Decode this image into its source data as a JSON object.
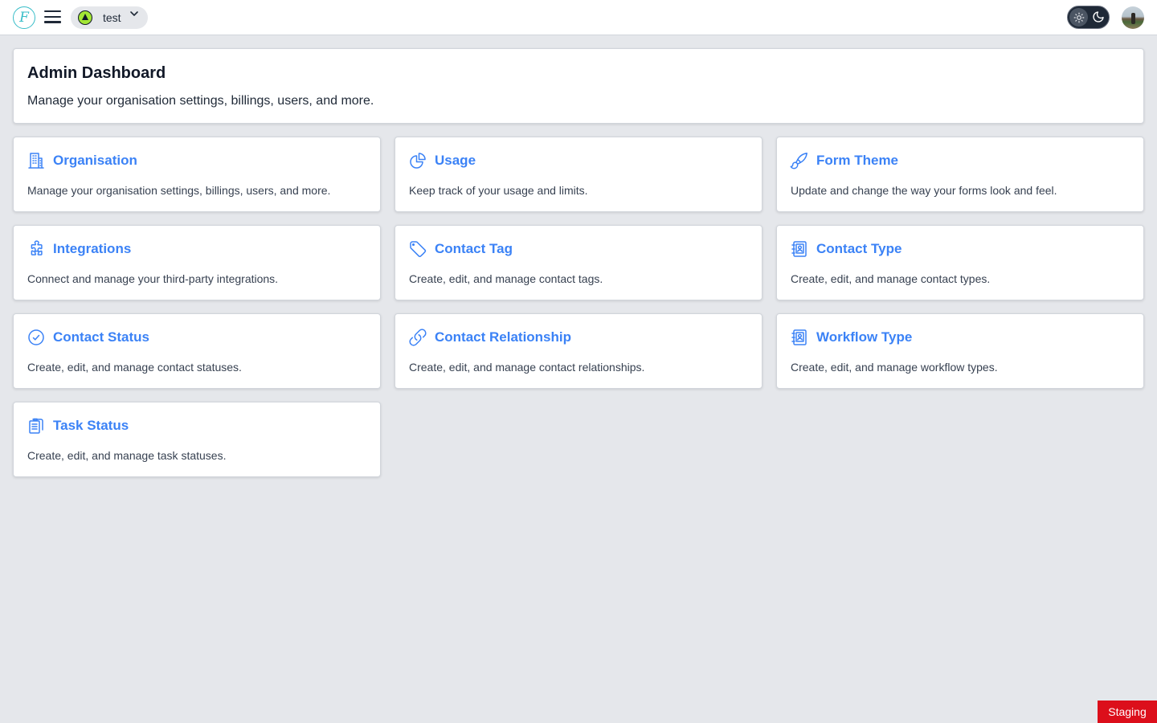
{
  "topbar": {
    "logo_letter": "F",
    "workspace_name": "test",
    "icons": [
      "logo-icon",
      "hamburger-icon",
      "chevron-down-icon",
      "sun-icon",
      "moon-icon"
    ]
  },
  "header": {
    "title": "Admin Dashboard",
    "subtitle": "Manage your organisation settings, billings, users, and more."
  },
  "tiles": [
    {
      "title": "Organisation",
      "description": "Manage your organisation settings, billings, users, and more.",
      "icon": "building-icon"
    },
    {
      "title": "Usage",
      "description": "Keep track of your usage and limits.",
      "icon": "pie-chart-icon"
    },
    {
      "title": "Form Theme",
      "description": "Update and change the way your forms look and feel.",
      "icon": "paintbrush-icon"
    },
    {
      "title": "Integrations",
      "description": "Connect and manage your third-party integrations.",
      "icon": "puzzle-icon"
    },
    {
      "title": "Contact Tag",
      "description": "Create, edit, and manage contact tags.",
      "icon": "tag-icon"
    },
    {
      "title": "Contact Type",
      "description": "Create, edit, and manage contact types.",
      "icon": "contact-book-icon"
    },
    {
      "title": "Contact Status",
      "description": "Create, edit, and manage contact statuses.",
      "icon": "check-circle-icon"
    },
    {
      "title": "Contact Relationship",
      "description": "Create, edit, and manage contact relationships.",
      "icon": "link-icon"
    },
    {
      "title": "Workflow Type",
      "description": "Create, edit, and manage workflow types.",
      "icon": "contact-book-icon"
    },
    {
      "title": "Task Status",
      "description": "Create, edit, and manage task statuses.",
      "icon": "clipboard-icon"
    }
  ],
  "badge": {
    "label": "Staging",
    "color": "#dc0f1b"
  },
  "colors": {
    "accent": "#3b82f6",
    "background": "#e5e7eb",
    "logo": "#38bdc8"
  }
}
